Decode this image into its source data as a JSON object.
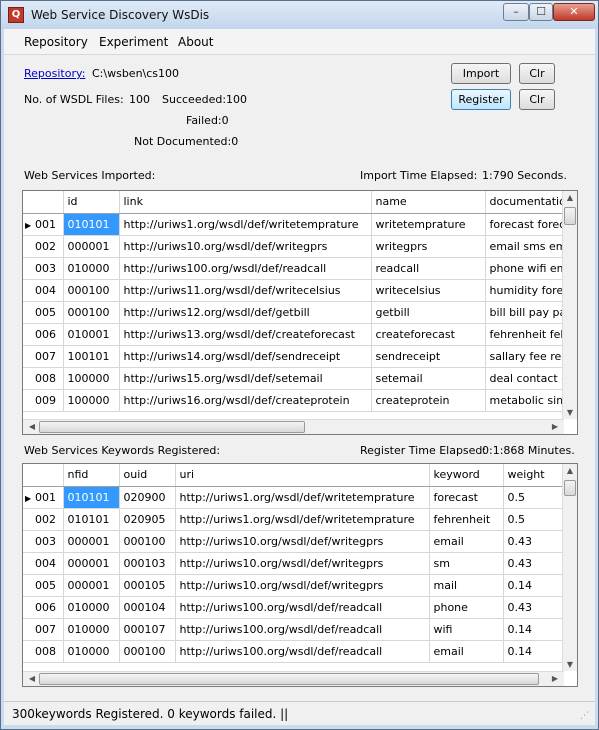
{
  "window": {
    "title": "Web Service Discovery WsDis",
    "controls": {
      "minimize": "–",
      "maximize": "☐",
      "close": "✕"
    }
  },
  "menu": [
    "Repository",
    "Experiment",
    "About"
  ],
  "repository": {
    "link_label": "Repository:",
    "path": "C:\\wsben\\cs100",
    "wsdl_files_label": "No. of WSDL Files:",
    "wsdl_files_value": "100",
    "succeeded": "Succeeded:100",
    "failed": "Failed:0",
    "not_documented": "Not Documented:0"
  },
  "buttons": {
    "import": "Import",
    "clr1": "Clr",
    "register": "Register",
    "clr2": "Clr"
  },
  "imported": {
    "section_label": "Web Services Imported:",
    "time_label": "Import Time Elapsed:",
    "time_value": "1:790 Seconds.",
    "columns": [
      "id",
      "link",
      "name",
      "documentation"
    ],
    "rows": [
      {
        "num": "001",
        "id": "010101",
        "link": "http://uriws1.org/wsdl/def/writetemprature",
        "name": "writetemprature",
        "doc": "forecast forecast"
      },
      {
        "num": "002",
        "id": "000001",
        "link": "http://uriws10.org/wsdl/def/writegprs",
        "name": "writegprs",
        "doc": "email sms email"
      },
      {
        "num": "003",
        "id": "010000",
        "link": "http://uriws100.org/wsdl/def/readcall",
        "name": "readcall",
        "doc": "phone wifi email"
      },
      {
        "num": "004",
        "id": "000100",
        "link": "http://uriws11.org/wsdl/def/writecelsius",
        "name": "writecelsius",
        "doc": "humidity forecast"
      },
      {
        "num": "005",
        "id": "000100",
        "link": "http://uriws12.org/wsdl/def/getbill",
        "name": "getbill",
        "doc": "bill bill pay pay"
      },
      {
        "num": "006",
        "id": "010001",
        "link": "http://uriws13.org/wsdl/def/createforecast",
        "name": "createforecast",
        "doc": "fehrenheit fehre"
      },
      {
        "num": "007",
        "id": "100101",
        "link": "http://uriws14.org/wsdl/def/sendreceipt",
        "name": "sendreceipt",
        "doc": "sallary fee repo"
      },
      {
        "num": "008",
        "id": "100000",
        "link": "http://uriws15.org/wsdl/def/setemail",
        "name": "setemail",
        "doc": "deal contact on"
      },
      {
        "num": "009",
        "id": "100000",
        "link": "http://uriws16.org/wsdl/def/createprotein",
        "name": "createprotein",
        "doc": "metabolic simila"
      }
    ]
  },
  "registered": {
    "section_label": "Web Services Keywords Registered:",
    "time_label": "Register Time Elapsed:",
    "time_value": "0:1:868 Minutes.",
    "columns": [
      "nfid",
      "ouid",
      "uri",
      "keyword",
      "weight"
    ],
    "rows": [
      {
        "num": "001",
        "nfid": "010101",
        "ouid": "020900",
        "uri": "http://uriws1.org/wsdl/def/writetemprature",
        "keyword": "forecast",
        "weight": "0.5"
      },
      {
        "num": "002",
        "nfid": "010101",
        "ouid": "020905",
        "uri": "http://uriws1.org/wsdl/def/writetemprature",
        "keyword": "fehrenheit",
        "weight": "0.5"
      },
      {
        "num": "003",
        "nfid": "000001",
        "ouid": "000100",
        "uri": "http://uriws10.org/wsdl/def/writegprs",
        "keyword": "email",
        "weight": "0.43"
      },
      {
        "num": "004",
        "nfid": "000001",
        "ouid": "000103",
        "uri": "http://uriws10.org/wsdl/def/writegprs",
        "keyword": "sm",
        "weight": "0.43"
      },
      {
        "num": "005",
        "nfid": "000001",
        "ouid": "000105",
        "uri": "http://uriws10.org/wsdl/def/writegprs",
        "keyword": "mail",
        "weight": "0.14"
      },
      {
        "num": "006",
        "nfid": "010000",
        "ouid": "000104",
        "uri": "http://uriws100.org/wsdl/def/readcall",
        "keyword": "phone",
        "weight": "0.43"
      },
      {
        "num": "007",
        "nfid": "010000",
        "ouid": "000107",
        "uri": "http://uriws100.org/wsdl/def/readcall",
        "keyword": "wifi",
        "weight": "0.14"
      },
      {
        "num": "008",
        "nfid": "010000",
        "ouid": "000100",
        "uri": "http://uriws100.org/wsdl/def/readcall",
        "keyword": "email",
        "weight": "0.14"
      }
    ]
  },
  "status": "300keywords Registered. 0 keywords failed. ||"
}
